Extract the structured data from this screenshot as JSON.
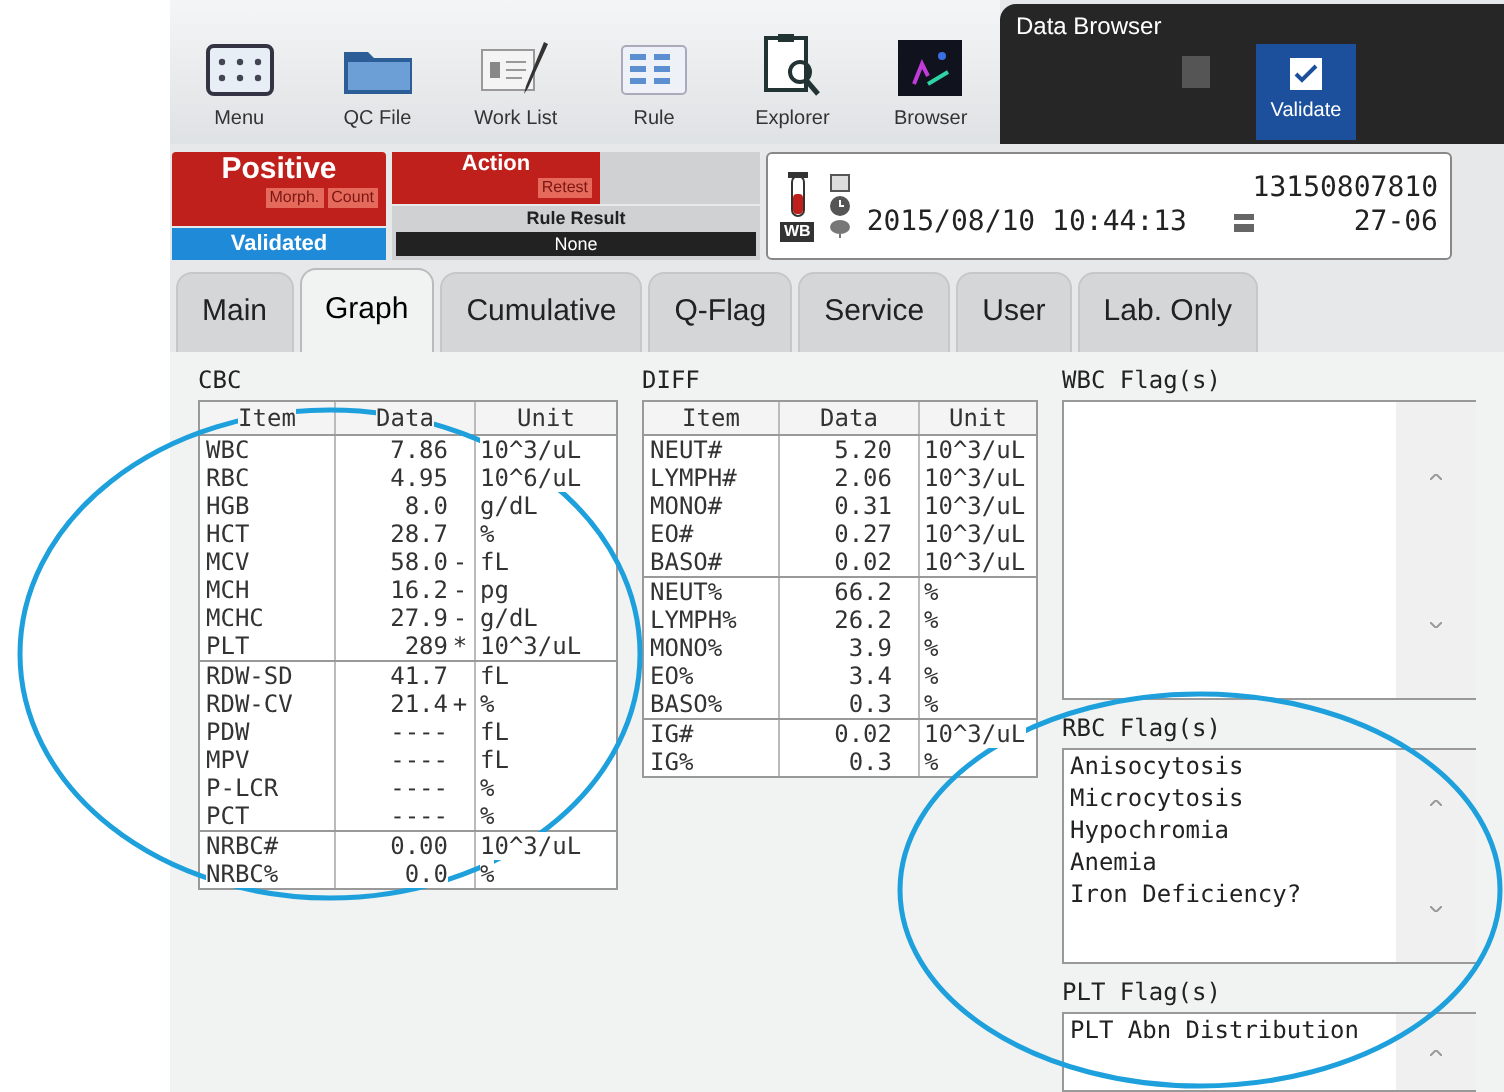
{
  "toolbar": [
    {
      "label": "Menu"
    },
    {
      "label": "QC File"
    },
    {
      "label": "Work List"
    },
    {
      "label": "Rule"
    },
    {
      "label": "Explorer"
    },
    {
      "label": "Browser"
    }
  ],
  "data_browser": {
    "title": "Data Browser",
    "validate_button": {
      "label": "Validate",
      "selected": true
    }
  },
  "status": {
    "result": "Positive",
    "result_tags": [
      "Morph.",
      "Count"
    ],
    "validation": "Validated",
    "action": {
      "title": "Action",
      "tags": [
        "Retest"
      ]
    },
    "rule_result": {
      "title": "Rule Result",
      "value": "None"
    }
  },
  "sample": {
    "tube_label": "WB",
    "number": "13150807810",
    "datetime": "2015/08/10 10:44:13",
    "rack": "27-06"
  },
  "tabs": [
    {
      "label": "Main",
      "selected": false
    },
    {
      "label": "Graph",
      "selected": true
    },
    {
      "label": "Cumulative",
      "selected": false
    },
    {
      "label": "Q-Flag",
      "selected": false
    },
    {
      "label": "Service",
      "selected": false
    },
    {
      "label": "User",
      "selected": false
    },
    {
      "label": "Lab. Only",
      "selected": false
    }
  ],
  "cbc": {
    "title": "CBC",
    "columns": [
      "Item",
      "Data",
      "Unit"
    ],
    "groups": [
      [
        {
          "item": "WBC",
          "data": "7.86",
          "unit": "10^3/uL"
        },
        {
          "item": "RBC",
          "data": "4.95",
          "unit": "10^6/uL"
        },
        {
          "item": "HGB",
          "data": "8.0",
          "unit": "g/dL"
        },
        {
          "item": "HCT",
          "data": "28.7",
          "unit": "%"
        },
        {
          "item": "MCV",
          "data": "58.0",
          "mark": "-",
          "unit": "fL"
        },
        {
          "item": "MCH",
          "data": "16.2",
          "mark": "-",
          "unit": "pg"
        },
        {
          "item": "MCHC",
          "data": "27.9",
          "mark": "-",
          "unit": "g/dL"
        },
        {
          "item": "PLT",
          "data": "289",
          "mark": "*",
          "unit": "10^3/uL"
        }
      ],
      [
        {
          "item": "RDW-SD",
          "data": "41.7",
          "unit": "fL"
        },
        {
          "item": "RDW-CV",
          "data": "21.4",
          "mark": "+",
          "unit": "%"
        },
        {
          "item": "PDW",
          "data": "----",
          "unit": "fL"
        },
        {
          "item": "MPV",
          "data": "----",
          "unit": "fL"
        },
        {
          "item": "P-LCR",
          "data": "----",
          "unit": "%"
        },
        {
          "item": "PCT",
          "data": "----",
          "unit": "%"
        }
      ],
      [
        {
          "item": "NRBC#",
          "data": "0.00",
          "unit": "10^3/uL"
        },
        {
          "item": "NRBC%",
          "data": "0.0",
          "unit": "%"
        }
      ]
    ]
  },
  "diff": {
    "title": "DIFF",
    "columns": [
      "Item",
      "Data",
      "Unit"
    ],
    "groups": [
      [
        {
          "item": "NEUT#",
          "data": "5.20",
          "unit": "10^3/uL"
        },
        {
          "item": "LYMPH#",
          "data": "2.06",
          "unit": "10^3/uL"
        },
        {
          "item": "MONO#",
          "data": "0.31",
          "unit": "10^3/uL"
        },
        {
          "item": "EO#",
          "data": "0.27",
          "unit": "10^3/uL"
        },
        {
          "item": "BASO#",
          "data": "0.02",
          "unit": "10^3/uL"
        }
      ],
      [
        {
          "item": "NEUT%",
          "data": "66.2",
          "unit": "%"
        },
        {
          "item": "LYMPH%",
          "data": "26.2",
          "unit": "%"
        },
        {
          "item": "MONO%",
          "data": "3.9",
          "unit": "%"
        },
        {
          "item": "EO%",
          "data": "3.4",
          "unit": "%"
        },
        {
          "item": "BASO%",
          "data": "0.3",
          "unit": "%"
        }
      ],
      [
        {
          "item": "IG#",
          "data": "0.02",
          "unit": "10^3/uL"
        },
        {
          "item": "IG%",
          "data": "0.3",
          "unit": "%"
        }
      ]
    ]
  },
  "flags": [
    {
      "title": "WBC Flag(s)"
    },
    {
      "title": "RBC Flag(s)",
      "items": [
        "Anisocytosis",
        "Microcytosis",
        "Hypochromia",
        "Anemia",
        "Iron Deficiency?"
      ]
    },
    {
      "title": "PLT Flag(s)",
      "items": [
        "PLT Abn Distribution"
      ]
    }
  ]
}
